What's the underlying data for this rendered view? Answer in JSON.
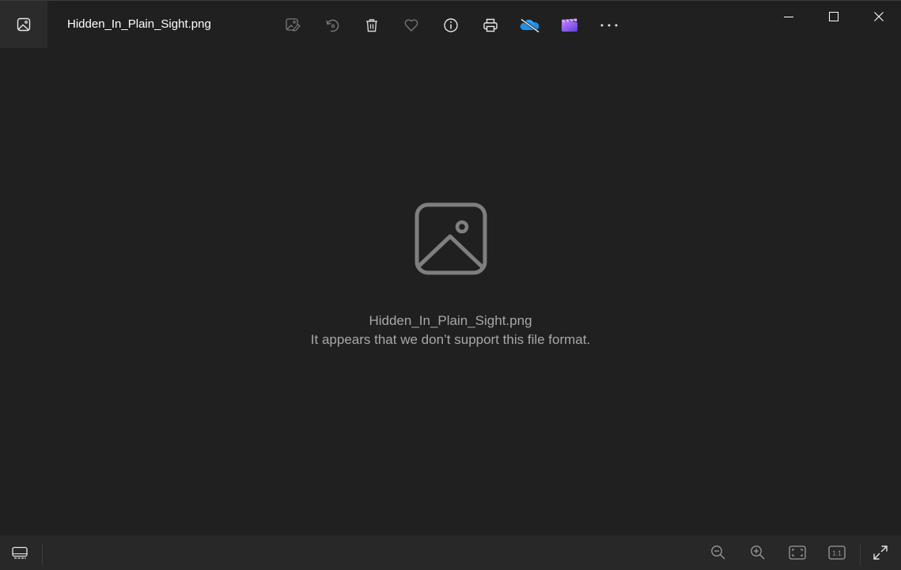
{
  "window": {
    "file_name": "Hidden_In_Plain_Sight.png"
  },
  "toolbar": {
    "buttons": [
      {
        "name": "edit-image",
        "icon": "edit-image-icon"
      },
      {
        "name": "rotate",
        "icon": "rotate-icon"
      },
      {
        "name": "delete",
        "icon": "trash-icon"
      },
      {
        "name": "favorite",
        "icon": "heart-icon"
      },
      {
        "name": "file-info",
        "icon": "info-icon"
      },
      {
        "name": "print",
        "icon": "printer-icon"
      },
      {
        "name": "onedrive",
        "icon": "cloud-off-icon"
      },
      {
        "name": "video-editor",
        "icon": "clipchamp-icon"
      },
      {
        "name": "more-options",
        "icon": "more-icon"
      }
    ]
  },
  "window_controls": {
    "minimize_icon": "minimize-icon",
    "maximize_icon": "maximize-icon",
    "close_icon": "close-icon"
  },
  "content": {
    "placeholder_icon": "image-placeholder-icon",
    "file_name": "Hidden_In_Plain_Sight.png",
    "error_message": "It appears that we don’t support this file format."
  },
  "bottombar": {
    "filmstrip_icon": "filmstrip-icon",
    "zoom_out_icon": "zoom-out-icon",
    "zoom_in_icon": "zoom-in-icon",
    "fit_icon": "fit-to-window-icon",
    "actual_size_icon": "actual-size-icon",
    "actual_size_label": "1:1",
    "fullscreen_icon": "fullscreen-icon"
  },
  "colors": {
    "background": "#202020",
    "bottom_bar": "#282828",
    "icon": "#d6d6d6",
    "muted_text": "#a8a8a8",
    "onedrive_blue": "#1e90e8",
    "clipchamp_purple": "#8c5cf6"
  }
}
